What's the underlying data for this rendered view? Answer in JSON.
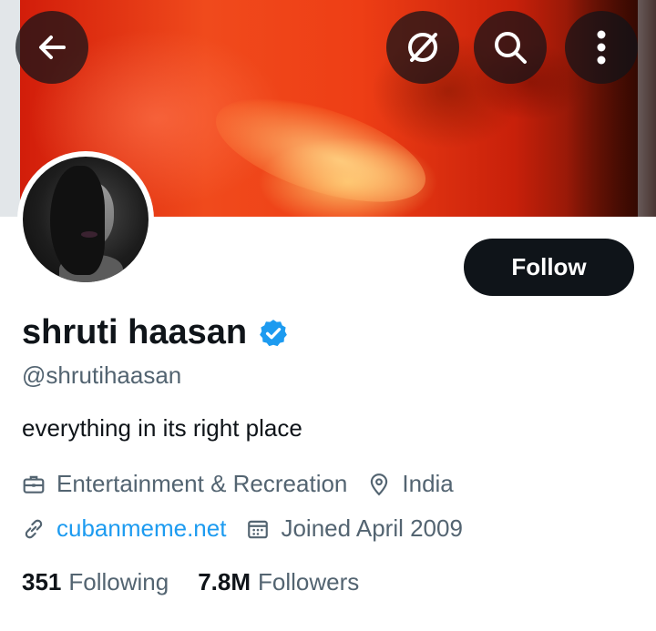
{
  "header": {
    "back_icon": "arrow-left-icon",
    "grok_icon": "grok-icon",
    "search_icon": "search-icon",
    "more_icon": "more-vertical-icon"
  },
  "profile": {
    "display_name": "shruti haasan",
    "verified_icon": "verified-badge-icon",
    "verified_color": "#1d9bf0",
    "handle": "@shrutihaasan",
    "bio": "everything in its right place",
    "category": "Entertainment & Recreation",
    "category_icon": "briefcase-icon",
    "location": "India",
    "location_icon": "location-pin-icon",
    "website": "cubanmeme.net",
    "website_icon": "link-icon",
    "joined": "Joined April 2009",
    "joined_icon": "calendar-icon"
  },
  "actions": {
    "follow_label": "Follow"
  },
  "stats": {
    "following_count": "351",
    "following_label": "Following",
    "followers_count": "7.8M",
    "followers_label": "Followers"
  },
  "colors": {
    "text_primary": "#0f1419",
    "text_secondary": "#536471",
    "accent_blue": "#1d9bf0",
    "button_dark": "#0f1419"
  }
}
